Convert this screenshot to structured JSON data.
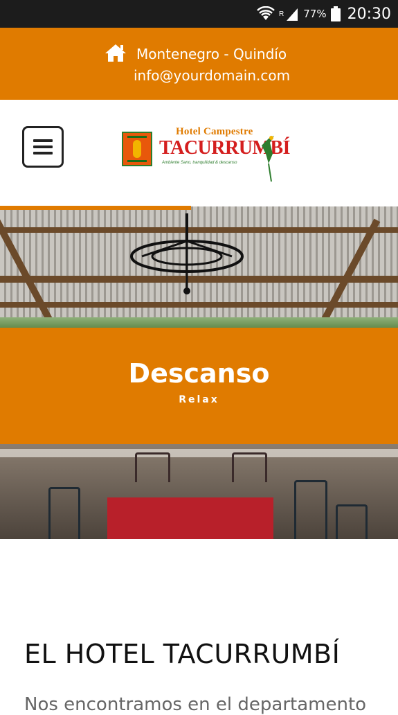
{
  "status_bar": {
    "battery": "77%",
    "time": "20:30",
    "roaming": "R"
  },
  "top_bar": {
    "location": "Montenegro - Quindío",
    "email": "info@yourdomain.com"
  },
  "logo": {
    "line1": "Hotel Campestre",
    "line2": "TACURRUMBÍ",
    "tagline": "Ambiente Sano, tranquilidad & descanso"
  },
  "slider": {
    "title": "Descanso",
    "subtitle": "Relax",
    "progress": 0.48
  },
  "content": {
    "heading": "EL HOTEL TACURRUMBÍ",
    "text": "Nos encontramos en el departamento"
  },
  "colors": {
    "accent": "#e07b00",
    "status_bar": "#1c1c1c"
  },
  "icons": {
    "location": "home-icon",
    "menu": "hamburger-menu-icon"
  }
}
